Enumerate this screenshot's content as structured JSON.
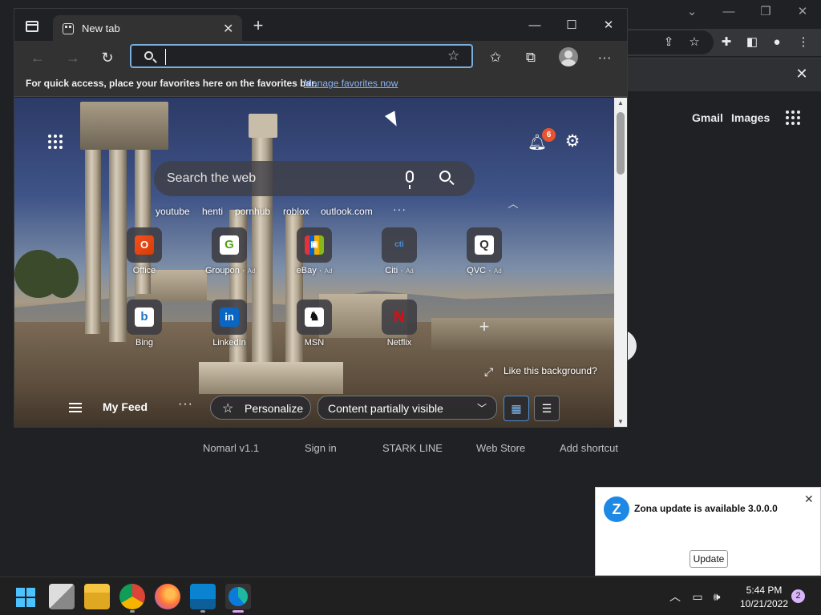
{
  "background_window": {
    "header_links": [
      "Gmail",
      "Images"
    ],
    "shortcut_labels": [
      "Nomarl v1.1",
      "Sign in",
      "STARK LINE",
      "Web Store",
      "Add shortcut"
    ]
  },
  "edge": {
    "tab_title": "New tab",
    "address_value": "",
    "favorites_bar": {
      "message": "For quick access, place your favorites here on the favorites bar.",
      "link": "Manage favorites now"
    },
    "ntp": {
      "search_placeholder": "Search the web",
      "notification_count": "6",
      "suggestions": [
        "youtube",
        "henti",
        "pornhub",
        "roblox",
        "outlook.com"
      ],
      "tiles": [
        {
          "label": "Office",
          "ad": ""
        },
        {
          "label": "Groupon",
          "ad": "Ad"
        },
        {
          "label": "eBay",
          "ad": "Ad"
        },
        {
          "label": "Citi",
          "ad": "Ad"
        },
        {
          "label": "QVC",
          "ad": "Ad"
        },
        {
          "label": "Bing",
          "ad": ""
        },
        {
          "label": "LinkedIn",
          "ad": ""
        },
        {
          "label": "MSN",
          "ad": ""
        },
        {
          "label": "Netflix",
          "ad": ""
        }
      ],
      "like_background": "Like this background?",
      "feed": {
        "title": "My Feed",
        "personalize": "Personalize",
        "content_select": "Content partially visible"
      }
    }
  },
  "toast": {
    "message": "Zona update is available 3.0.0.0",
    "button": "Update"
  },
  "taskbar": {
    "time": "5:44 PM",
    "date": "10/21/2022",
    "notifications": "2"
  },
  "colors": {
    "edge_accent": "#78aede",
    "link": "#8ab4f8",
    "badge": "#e8542f",
    "zona_blue": "#1e88e5"
  }
}
